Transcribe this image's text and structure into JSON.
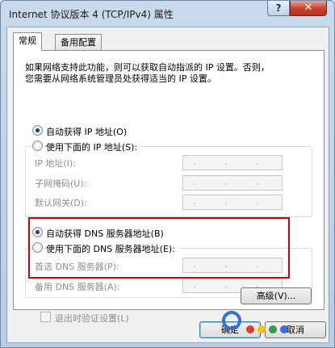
{
  "window": {
    "title": "Internet 协议版本 4 (TCP/IPv4) 属性",
    "help_label": "?",
    "close_label": "✕"
  },
  "tabs": [
    {
      "label": "常规"
    },
    {
      "label": "备用配置"
    }
  ],
  "description": {
    "line1": "如果网络支持此功能，则可以获取自动指派的 IP 设置。否则，",
    "line2": "您需要从网络系统管理员处获得适当的 IP 设置。"
  },
  "ip": {
    "auto_label": "自动获得 IP 地址(O)",
    "manual_label": "使用下面的 IP 地址(S):",
    "fields": [
      {
        "label": "IP 地址(I):",
        "value": ". . ."
      },
      {
        "label": "子网掩码(U):",
        "value": ". . ."
      },
      {
        "label": "默认网关(D):",
        "value": ". . ."
      }
    ]
  },
  "dns": {
    "auto_label": "自动获得 DNS 服务器地址(B)",
    "manual_label": "使用下面的 DNS 服务器地址(E):",
    "fields": [
      {
        "label": "首选 DNS 服务器(P):",
        "value": ". . ."
      },
      {
        "label": "备用 DNS 服务器(A):",
        "value": ". . ."
      }
    ]
  },
  "validate_label": "退出时验证设置(L)",
  "advanced_label": "高级(V)...",
  "ok_label": "确定",
  "cancel_label": "取消",
  "colors": {
    "highlight_box": "#d10000",
    "radio_dot": "#1d3f8a"
  }
}
